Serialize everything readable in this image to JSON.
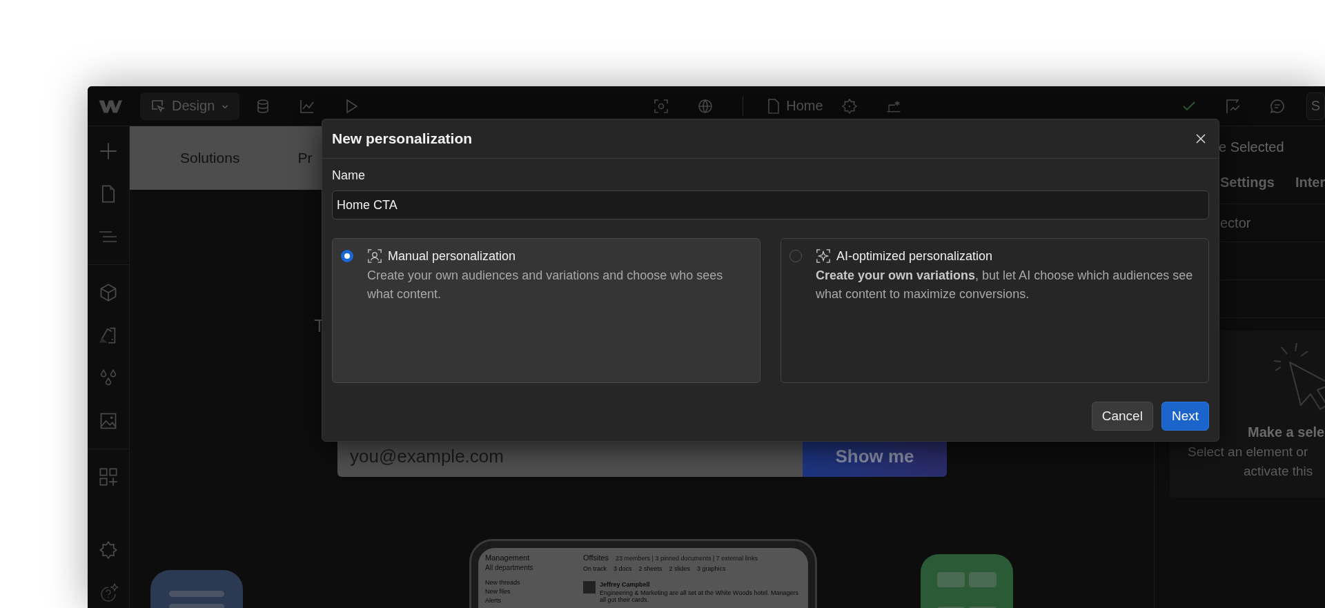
{
  "toolbar": {
    "mode_button": "Design",
    "page_name": "Home",
    "publish_button": "S"
  },
  "canvas": {
    "nav_items": [
      "Solutions",
      "Pr"
    ],
    "headline": "T",
    "email_field": {
      "placeholder": "you@example.com"
    },
    "submit_button": "Show me",
    "device_screenshot": {
      "workspace": "Management",
      "department": "All departments",
      "sidebar_items": [
        "New threads",
        "New files",
        "Alerts"
      ],
      "channel": "Offsites",
      "channel_meta": "23 members | 3 pinned documents | 7 external links",
      "chips": [
        "On track",
        "3 docs",
        "2 sheets",
        "2 slides",
        "3 graphics"
      ],
      "message": {
        "author": "Jeffrey Campbell",
        "text": "Engineering & Marketing are all set at the White Woods hotel. Managers all got their cards."
      }
    }
  },
  "right_panel": {
    "heading": "e Selected",
    "tabs": [
      "Settings",
      "Inter"
    ],
    "selector_label": "ector",
    "empty_state": {
      "title": "Make a sele",
      "lines": [
        "Select an element or",
        "activate this"
      ]
    }
  },
  "dialog": {
    "title": "New personalization",
    "name_label": "Name",
    "name_value": "Home CTA",
    "options": [
      {
        "kind": "manual",
        "title": "Manual personalization",
        "description": "Create your own audiences and variations and choose who sees what content.",
        "selected": true
      },
      {
        "kind": "ai",
        "title": "AI-optimized personalization",
        "description": "**Create your own variations**, but let AI choose which audiences see what content to maximize conversions.",
        "selected": false
      }
    ],
    "buttons": [
      {
        "kind": "secondary",
        "label": "Cancel"
      },
      {
        "kind": "primary",
        "label": "Next"
      }
    ]
  }
}
